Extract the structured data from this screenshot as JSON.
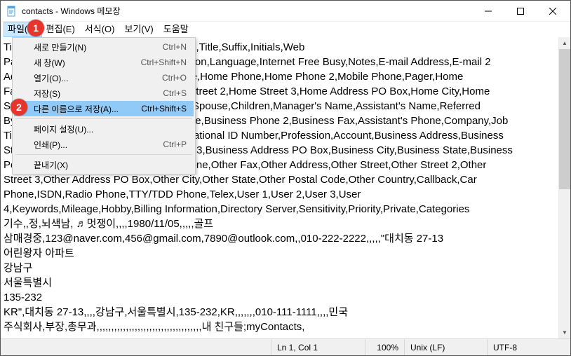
{
  "window": {
    "title": "contacts - Windows 메모장"
  },
  "menubar": {
    "file": "파일(F)",
    "edit": "편집(E)",
    "format": "서식(O)",
    "view": "보기(V)",
    "help": "도움말"
  },
  "file_menu": {
    "new": {
      "label": "새로 만들기(N)",
      "shortcut": "Ctrl+N"
    },
    "new_window": {
      "label": "새 창(W)",
      "shortcut": "Ctrl+Shift+N"
    },
    "open": {
      "label": "열기(O)...",
      "shortcut": "Ctrl+O"
    },
    "save": {
      "label": "저장(S)",
      "shortcut": "Ctrl+S"
    },
    "save_as": {
      "label": "다른 이름으로 저장(A)...",
      "shortcut": "Ctrl+Shift+S"
    },
    "page_setup": {
      "label": "페이지 설정(U)...",
      "shortcut": ""
    },
    "print": {
      "label": "인쇄(P)...",
      "shortcut": "Ctrl+P"
    },
    "exit": {
      "label": "끝내기(X)",
      "shortcut": ""
    }
  },
  "content": "Title,First Name,Middle Name,Last Name,Title,Suffix,Initials,Web\nPage,Gender,Birthday,Anniversary,Location,Language,Internet Free Busy,Notes,E-mail Address,E-mail 2\nAddress,E-mail 3 Address,Primary Phone,Home Phone,Home Phone 2,Mobile Phone,Pager,Home\nFax,Home Address,Home Street,Home Street 2,Home Street 3,Home Address PO Box,Home City,Home\nState,Home Postal Code,Home Country,Spouse,Children,Manager's Name,Assistant's Name,Referred\nBy,Company Main Phone,Business Phone,Business Phone 2,Business Fax,Assistant's Phone,Company,Job\nTitle,Department,Office Location,Organizational ID Number,Profession,Account,Business Address,Business\nStreet,Business Street 2,Business Street 3,Business Address PO Box,Business City,Business State,Business\nPostal Code,Business Country,Other Phone,Other Fax,Other Address,Other Street,Other Street 2,Other\nStreet 3,Other Address PO Box,Other City,Other State,Other Postal Code,Other Country,Callback,Car\nPhone,ISDN,Radio Phone,TTY/TDD Phone,Telex,User 1,User 2,User 3,User\n4,Keywords,Mileage,Hobby,Billing Information,Directory Server,Sensitivity,Priority,Private,Categories\n기수,,정,뇌색남, ♬멋쟁이,,,,1980/11/05,,,,,골프\n삼매경중,123@naver.com,456@gmail.com,7890@outlook.com,,010-222-2222,,,,,\"대치동 27-13\n어린왕자 아파트\n강남구\n서울특별시\n135-232\nKR\",대치동 27-13,,,,강남구,서울특별시,135-232,KR,,,,,,,010-111-1111,,,,민국\n주식회사,부장,총무과,,,,,,,,,,,,,,,,,,,,,,,,,,,,,,,,,,,,내 친구들;myContacts,",
  "status": {
    "pos": "Ln 1, Col 1",
    "zoom": "100%",
    "eol": "Unix (LF)",
    "enc": "UTF-8"
  },
  "markers": {
    "m1": "1",
    "m2": "2"
  }
}
